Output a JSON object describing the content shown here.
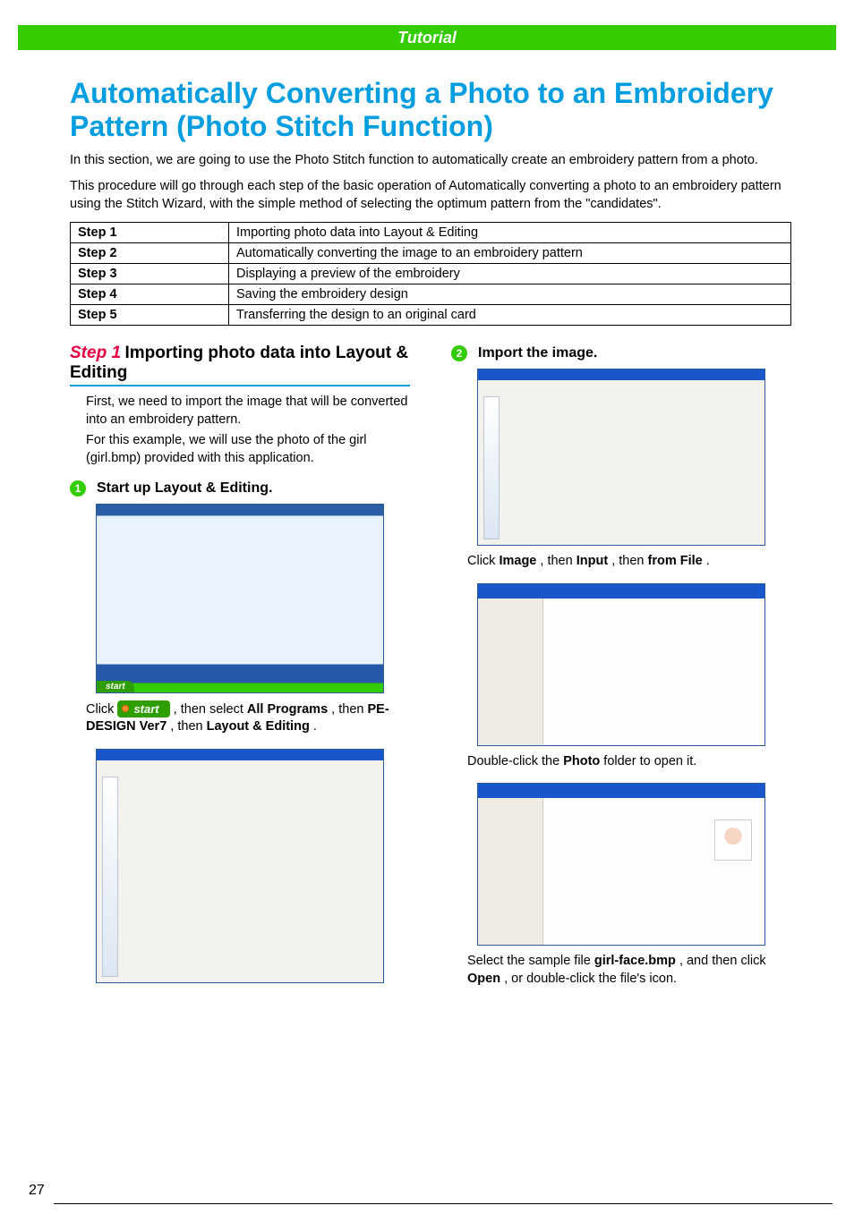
{
  "header": {
    "band": "Tutorial"
  },
  "title": "Automatically Converting a Photo to an Embroidery Pattern (Photo Stitch Function)",
  "intro_p1": "In this section, we are going to use the Photo Stitch function to automatically create an embroidery pattern from a photo.",
  "intro_p2": "This procedure will go through each step of the basic operation of Automatically converting a photo to an embroidery pattern using the Stitch Wizard, with the simple method of selecting the optimum pattern from the \"candidates\".",
  "steps_table": [
    {
      "label": "Step 1",
      "desc": "Importing photo data into Layout & Editing"
    },
    {
      "label": "Step 2",
      "desc": "Automatically converting the image to an embroidery pattern"
    },
    {
      "label": "Step 3",
      "desc": "Displaying a preview of the embroidery"
    },
    {
      "label": "Step 4",
      "desc": "Saving the embroidery design"
    },
    {
      "label": "Step 5",
      "desc": "Transferring the design to an original card"
    }
  ],
  "step1": {
    "label": "Step 1",
    "title": "Importing photo data into Layout & Editing",
    "intro_a": "First, we need to import the image that will be converted into an embroidery pattern.",
    "intro_b": "For this example, we will use the photo of the girl (girl.bmp) provided with this application.",
    "sub1": {
      "num": "1",
      "title": "Start up Layout & Editing.",
      "caption_pre": "Click ",
      "start_label": "start",
      "caption_mid1": ", then select ",
      "all_programs": "All Programs",
      "caption_mid2": ", then ",
      "pe_design": "PE-DESIGN Ver7",
      "caption_mid3": ", then ",
      "layout_editing": "Layout & Editing",
      "caption_end": "."
    },
    "sub2": {
      "num": "2",
      "title": "Import the image.",
      "caption2_pre": "Click ",
      "caption2_image": "Image",
      "caption2_mid1": ", then ",
      "caption2_input": "Input",
      "caption2_mid2": ", then ",
      "caption2_fromfile": "from File",
      "caption2_end": ".",
      "caption3_pre": "Double-click the ",
      "caption3_photo": "Photo",
      "caption3_end": " folder to open it.",
      "caption4_pre": "Select the sample file ",
      "caption4_file": "girl-face.bmp",
      "caption4_mid": ", and then click ",
      "caption4_open": "Open",
      "caption4_end": ", or double-click the file's icon."
    }
  },
  "page_number": "27"
}
